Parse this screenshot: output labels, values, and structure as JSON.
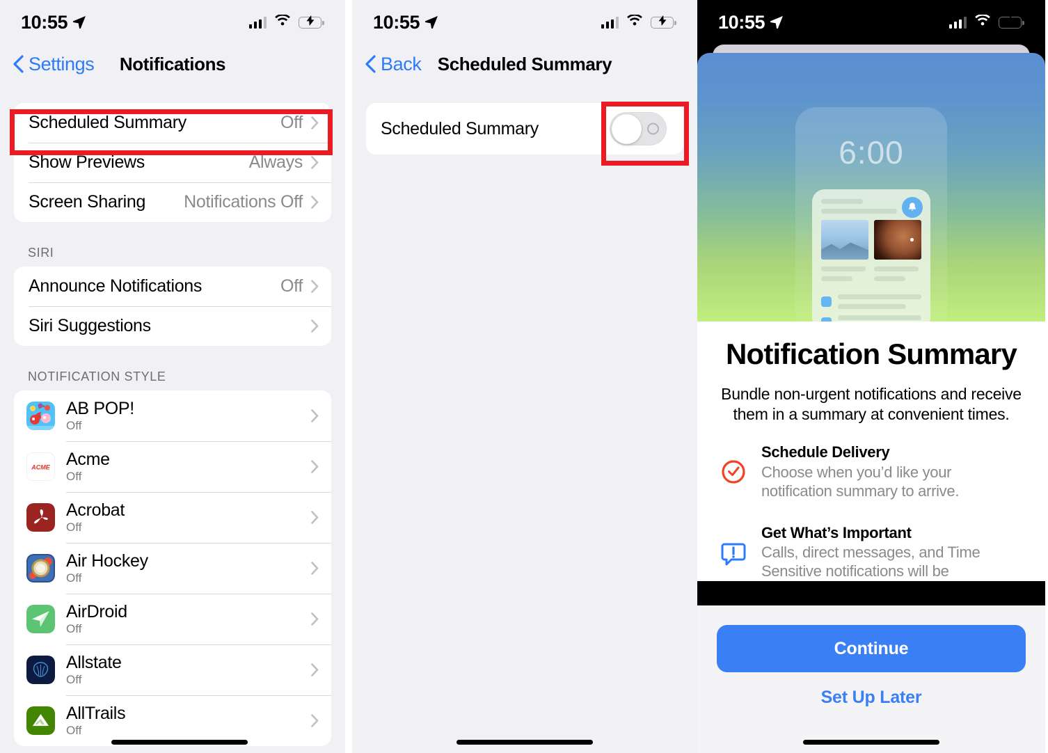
{
  "colors": {
    "accent_blue": "#3b7ff5",
    "link_blue": "#2b7bfb",
    "highlight_red": "#ea1b23",
    "panel_bg": "#f1f0f5",
    "secondary_text": "#8a8a8e",
    "battery_green": "#34c759"
  },
  "panel1": {
    "status": {
      "time": "10:55",
      "location_icon": "location-arrow-icon",
      "signal_icon": "cellular-signal-icon",
      "wifi_icon": "wifi-icon",
      "battery_icon": "battery-charging-icon"
    },
    "nav": {
      "back_label": "Settings",
      "back_icon": "chevron-left-icon",
      "title": "Notifications"
    },
    "group1": [
      {
        "title": "Scheduled Summary",
        "value": "Off"
      },
      {
        "title": "Show Previews",
        "value": "Always"
      },
      {
        "title": "Screen Sharing",
        "value": "Notifications Off"
      }
    ],
    "siri_header": "SIRI",
    "group2": [
      {
        "title": "Announce Notifications",
        "value": "Off"
      },
      {
        "title": "Siri Suggestions",
        "value": ""
      }
    ],
    "style_header": "NOTIFICATION STYLE",
    "apps": [
      {
        "name": "AB POP!",
        "status": "Off",
        "icon": "ab-pop-app-icon"
      },
      {
        "name": "Acme",
        "status": "Off",
        "icon": "acme-app-icon"
      },
      {
        "name": "Acrobat",
        "status": "Off",
        "icon": "acrobat-app-icon"
      },
      {
        "name": "Air Hockey",
        "status": "Off",
        "icon": "air-hockey-app-icon"
      },
      {
        "name": "AirDroid",
        "status": "Off",
        "icon": "airdroid-app-icon"
      },
      {
        "name": "Allstate",
        "status": "Off",
        "icon": "allstate-app-icon"
      },
      {
        "name": "AllTrails",
        "status": "Off",
        "icon": "alltrails-app-icon"
      }
    ]
  },
  "panel2": {
    "status": {
      "time": "10:55"
    },
    "nav": {
      "back_label": "Back",
      "title": "Scheduled Summary"
    },
    "row": {
      "title": "Scheduled Summary",
      "toggle_state": "off"
    }
  },
  "panel3": {
    "status": {
      "time": "10:55"
    },
    "hero": {
      "clock": "6:00",
      "bell_icon": "bell-icon"
    },
    "title": "Notification Summary",
    "subtitle": "Bundle non-urgent notifications and receive them in a summary at convenient times.",
    "features": [
      {
        "icon": "clock-check-icon",
        "heading": "Schedule Delivery",
        "desc": "Choose when you’d like your notification summary to arrive."
      },
      {
        "icon": "message-alert-icon",
        "heading": "Get What’s Important",
        "desc": "Calls, direct messages, and Time Sensitive notifications will be"
      }
    ],
    "primary_button": "Continue",
    "secondary_button": "Set Up Later"
  }
}
